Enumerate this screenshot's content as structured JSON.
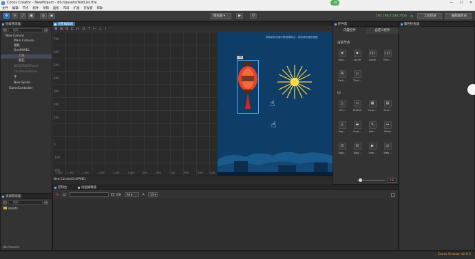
{
  "window": {
    "title": "Cocos Creator - NewProject - db://assets/TestList.fire",
    "badge": "-58",
    "buttons": [
      "—",
      "☐",
      "✕"
    ]
  },
  "menu": [
    "文件",
    "编辑",
    "节点",
    "组件",
    "项目",
    "面板",
    "布局",
    "扩展",
    "开发者",
    "帮助"
  ],
  "toolbar": {
    "platform": "模拟器",
    "ip": "192.168.0.136:7456",
    "project_button": "工程目录",
    "editor_button": "编辑器目录"
  },
  "hierarchy": {
    "title": "层级管理器",
    "search_placeholder": "搜索...",
    "nodes": [
      {
        "label": "New Canvas",
        "indent": 0
      },
      {
        "label": "Main Camera",
        "indent": 1
      },
      {
        "label": "相机",
        "indent": 1
      },
      {
        "label": "OnePANEL",
        "indent": 1
      },
      {
        "label": "灯笼",
        "indent": 2
      },
      {
        "label": "烟花",
        "indent": 2
      },
      {
        "label": "DESIGNEDPanel",
        "indent": 1
      },
      {
        "label": "ThirdlevelPanel",
        "indent": 1
      },
      {
        "label": "手",
        "indent": 1
      },
      {
        "label": "New Sprite",
        "indent": 1
      },
      {
        "label": "GameController",
        "indent": 0
      }
    ]
  },
  "assets": {
    "title": "资源管理器",
    "search_placeholder": "搜索...",
    "root": "assets",
    "path": "db://assets"
  },
  "scene": {
    "title": "场景编辑器",
    "hint": "使用鼠标右键平移视窗焦点，使用滚轮缩放视图",
    "y_ticks": [
      "700",
      "600",
      "500",
      "400",
      "300",
      "200",
      "100",
      "0",
      "-100",
      "-200"
    ],
    "x_ticks": [
      "-1,600",
      "-1,400",
      "-1,300",
      "-1,200",
      "-1,100",
      "-1,000",
      "-900",
      "-800",
      "-700",
      "-600",
      "-500",
      "-400",
      "-300",
      "-200",
      "-100",
      "0"
    ],
    "breadcrumb": "New Canvas/OnePANEL",
    "lantern_label": "灯笼"
  },
  "controls": {
    "title": "控件库",
    "tabs": [
      "内置控件",
      "自定义控件"
    ],
    "section_render": "渲染节点",
    "section_ui": "UI",
    "render_items": [
      "Spla...",
      "Sprite",
      "Label",
      "Rich...",
      "Parti...",
      "Tiled..."
    ],
    "ui_items": [
      "Can...",
      "Button",
      "Layo...",
      "Scro...",
      "Pag...",
      "Prog...",
      "Edit...",
      "Slider",
      "Togg...",
      "Togg...",
      "Vide...",
      "Web..."
    ],
    "zoom": "0.6"
  },
  "inspector": {
    "title": "属性检查器"
  },
  "console": {
    "tab_console": "控制台",
    "tab_anim": "动画编辑器",
    "regex": "正则",
    "filter": "All",
    "font_size": "14"
  },
  "status": {
    "version": "Cocos Creator v2.0.5"
  },
  "colors": {
    "accent": "#2d6db5",
    "selected_node": "#f0a030",
    "ip_text": "#65d36e",
    "status_text": "#f0a030"
  }
}
